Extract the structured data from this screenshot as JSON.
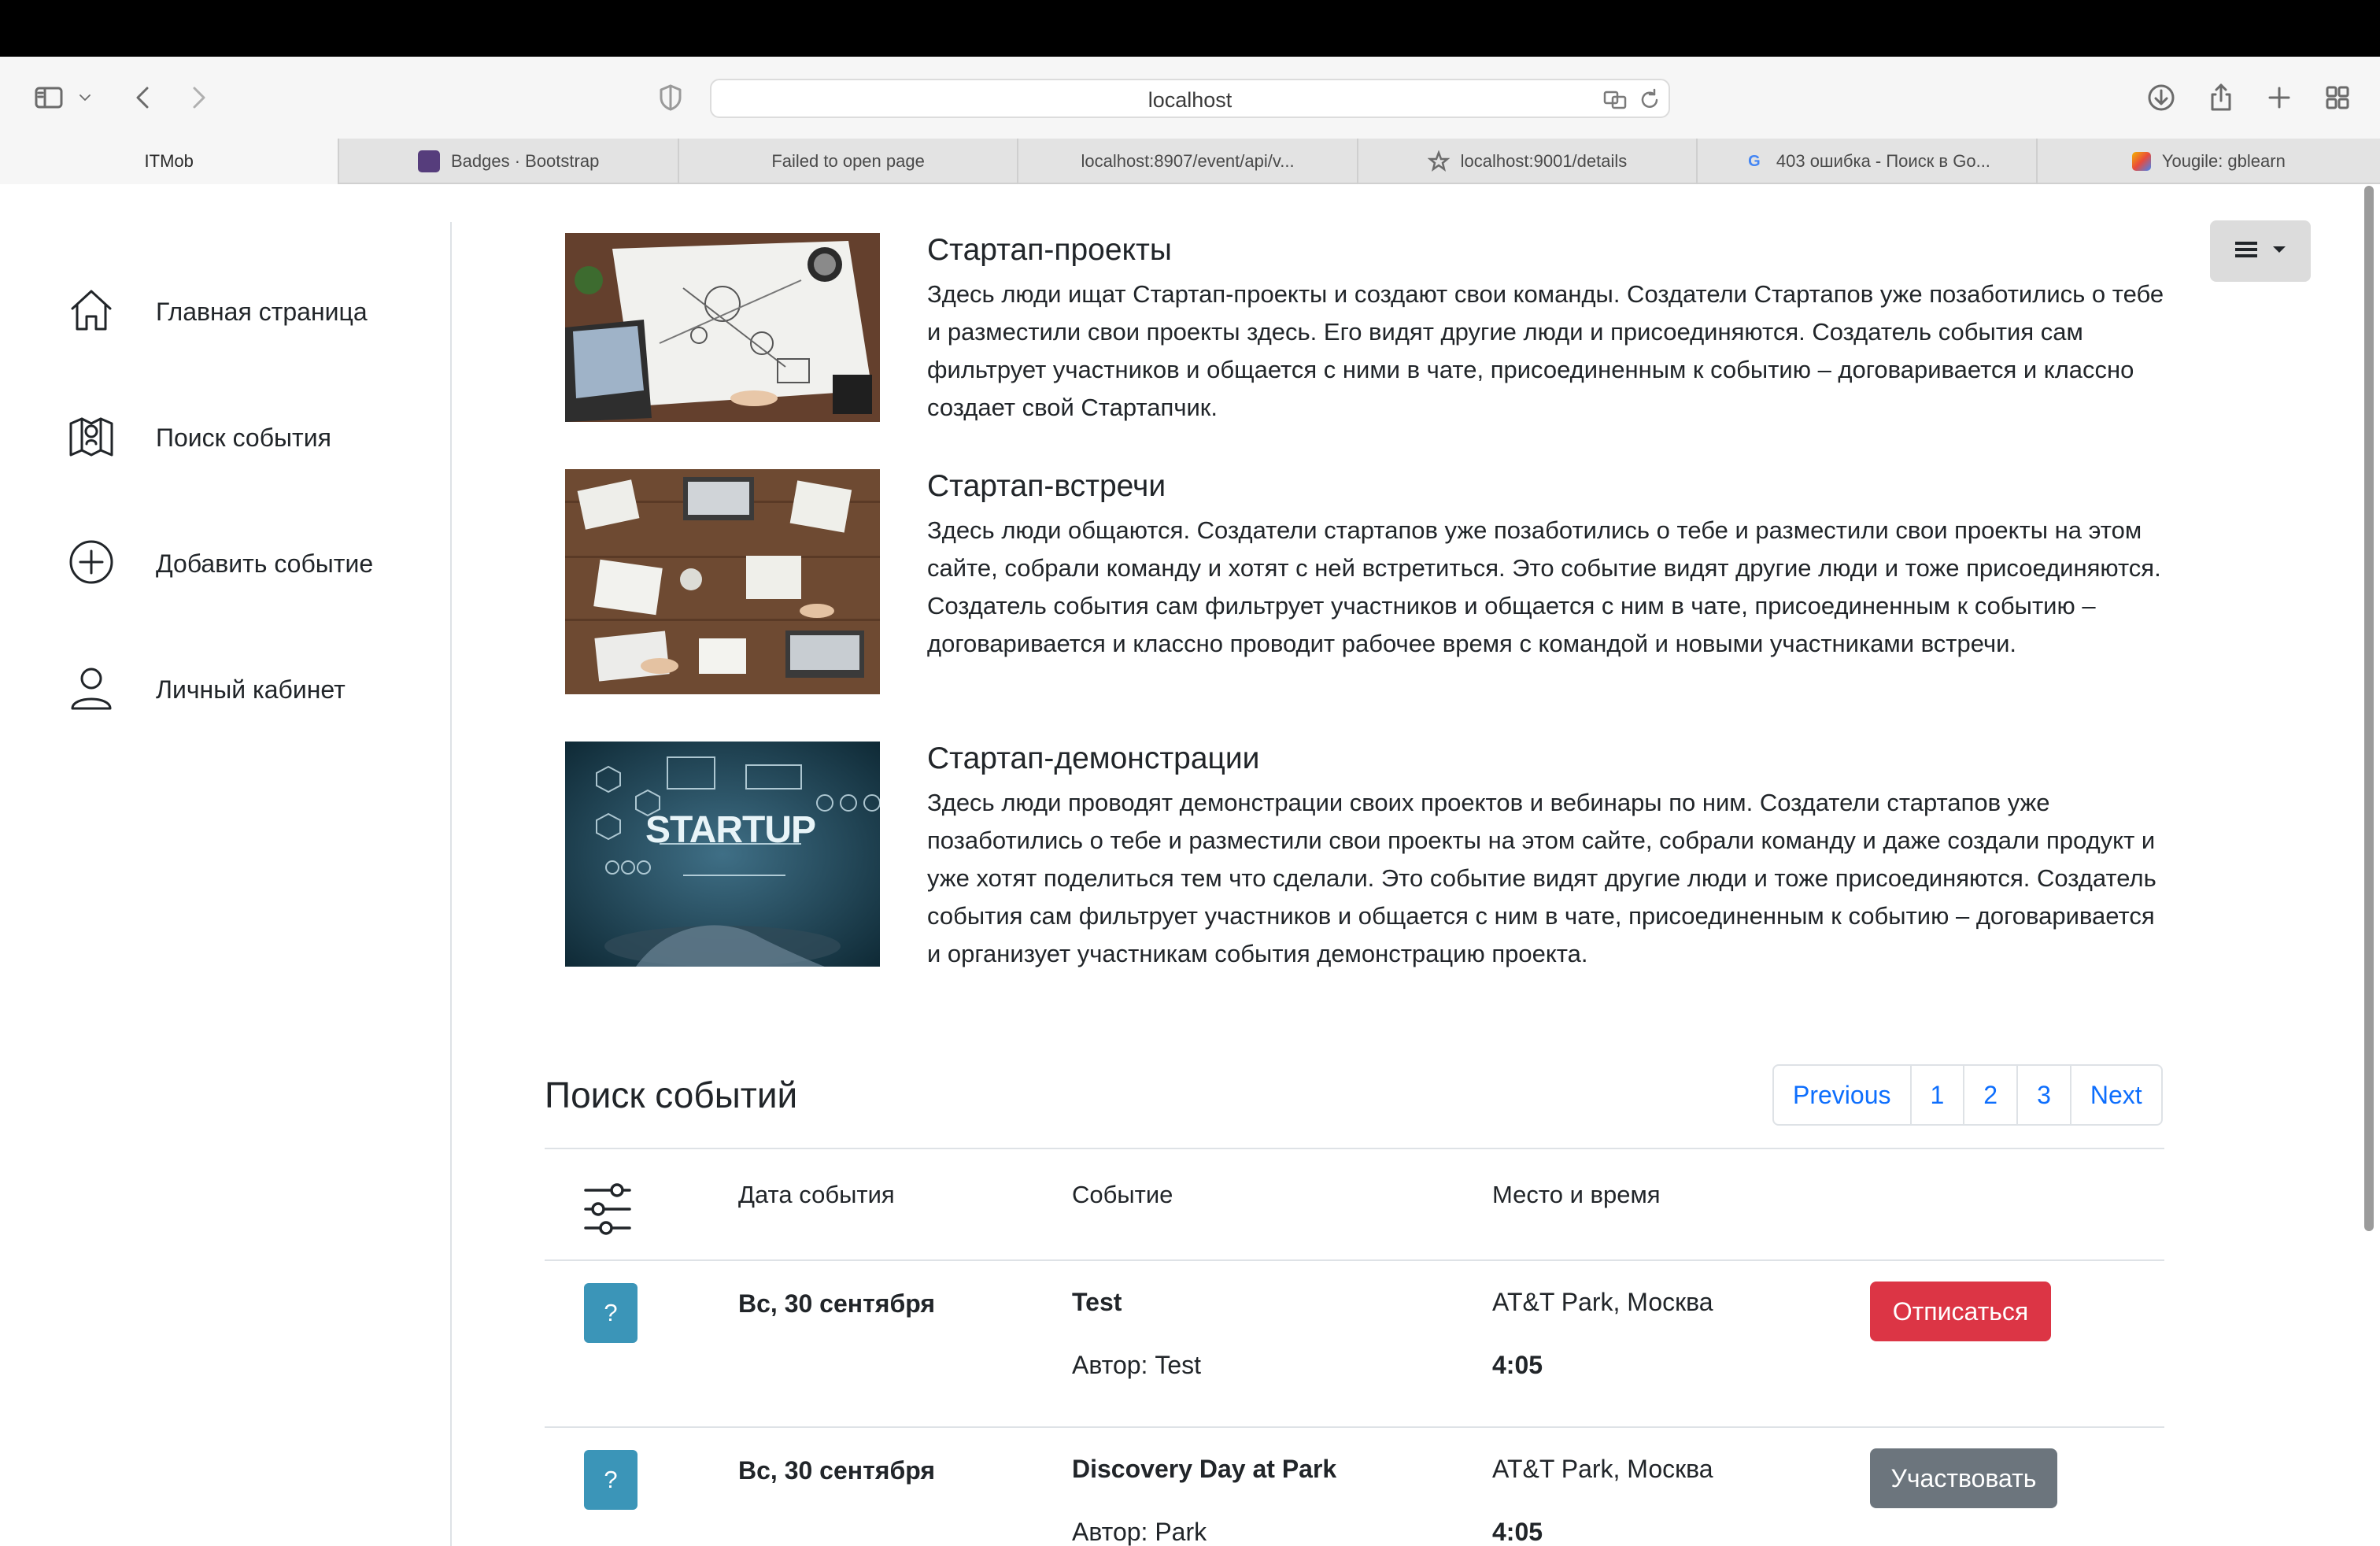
{
  "browser": {
    "url": "localhost",
    "tabs": [
      {
        "label": "ITMob",
        "favicon": "none",
        "active": true
      },
      {
        "label": "Badges · Bootstrap",
        "favicon": "bootstrap-icon"
      },
      {
        "label": "Failed to open page",
        "favicon": "none"
      },
      {
        "label": "localhost:8907/event/api/v...",
        "favicon": "none"
      },
      {
        "label": "localhost:9001/details",
        "favicon": "star-icon"
      },
      {
        "label": "403 ошибка - Поиск в Go...",
        "favicon": "google-icon"
      },
      {
        "label": "Yougile: gblearn",
        "favicon": "yougile-icon"
      }
    ],
    "google_glyph": "G"
  },
  "sidebar": {
    "items": [
      {
        "label": "Главная страница",
        "icon": "home-icon"
      },
      {
        "label": "Поиск события",
        "icon": "map-search-icon"
      },
      {
        "label": "Добавить событие",
        "icon": "plus-circle-icon"
      },
      {
        "label": "Личный кабинет",
        "icon": "user-icon"
      }
    ]
  },
  "features": [
    {
      "title": "Стартап-проекты",
      "text": "Здесь люди ищат Стартап-проекты и создают свои команды. Создатели Стартапов уже позаботились о тебе и разместили свои проекты здесь. Его видят другие люди и присоединяются. Создатель события сам фильтрует участников и общается с ними в чате, присоединенным к событию – договаривается и классно создает свой Стартапчик.",
      "image": "desk-with-laptop-and-sketches"
    },
    {
      "title": "Стартап-встречи",
      "text": "Здесь люди общаются. Создатели стартапов уже позаботились о тебе и разместили свои проекты на этом сайте, собрали команду и хотят с ней встретиться. Это событие видят другие люди и тоже присоединяются. Создатель события сам фильтрует участников и общается с ним в чате, присоединенным к событию – договаривается и классно проводит рабочее время с командой и новыми участниками встречи.",
      "image": "team-meeting-table-top-view"
    },
    {
      "title": "Стартап-демонстрации",
      "text": "Здесь люди проводят демонстрации своих проектов и вебинары по ним. Создатели стартапов уже позаботились о тебе и разместили свои проекты на этом сайте, собрали команду и даже создали продукт и уже хотят поделиться тем что сделали. Это событие видят другие люди и тоже присоединяются. Создатель события сам фильтрует участников и общается с ним в чате, присоединенным к событию – договаривается и организует участникам события демонстрацию проекта.",
      "image": "startup-hologram",
      "image_text": "STARTUP"
    }
  ],
  "events": {
    "title": "Поиск событий",
    "pagination": [
      "Previous",
      "1",
      "2",
      "3",
      "Next"
    ],
    "columns": {
      "date": "Дата события",
      "event": "Событие",
      "place": "Место и время"
    },
    "badge": "?",
    "rows": [
      {
        "date": "Вс, 30 сентября",
        "name": "Test",
        "author": "Автор: Test",
        "place": "AT&T Park, Москва",
        "time": "4:05",
        "action": "Отписаться",
        "action_style": "danger"
      },
      {
        "date": "Вс, 30 сентября",
        "name": "Discovery Day at Park",
        "author": "Автор: Park",
        "place": "AT&T Park, Москва",
        "time": "4:05",
        "action": "Участвовать",
        "action_style": "secondary"
      }
    ]
  },
  "colors": {
    "primary": "#0d6efd",
    "danger": "#dc3545",
    "secondary": "#6c757d",
    "info_badge": "#3b95b8"
  }
}
